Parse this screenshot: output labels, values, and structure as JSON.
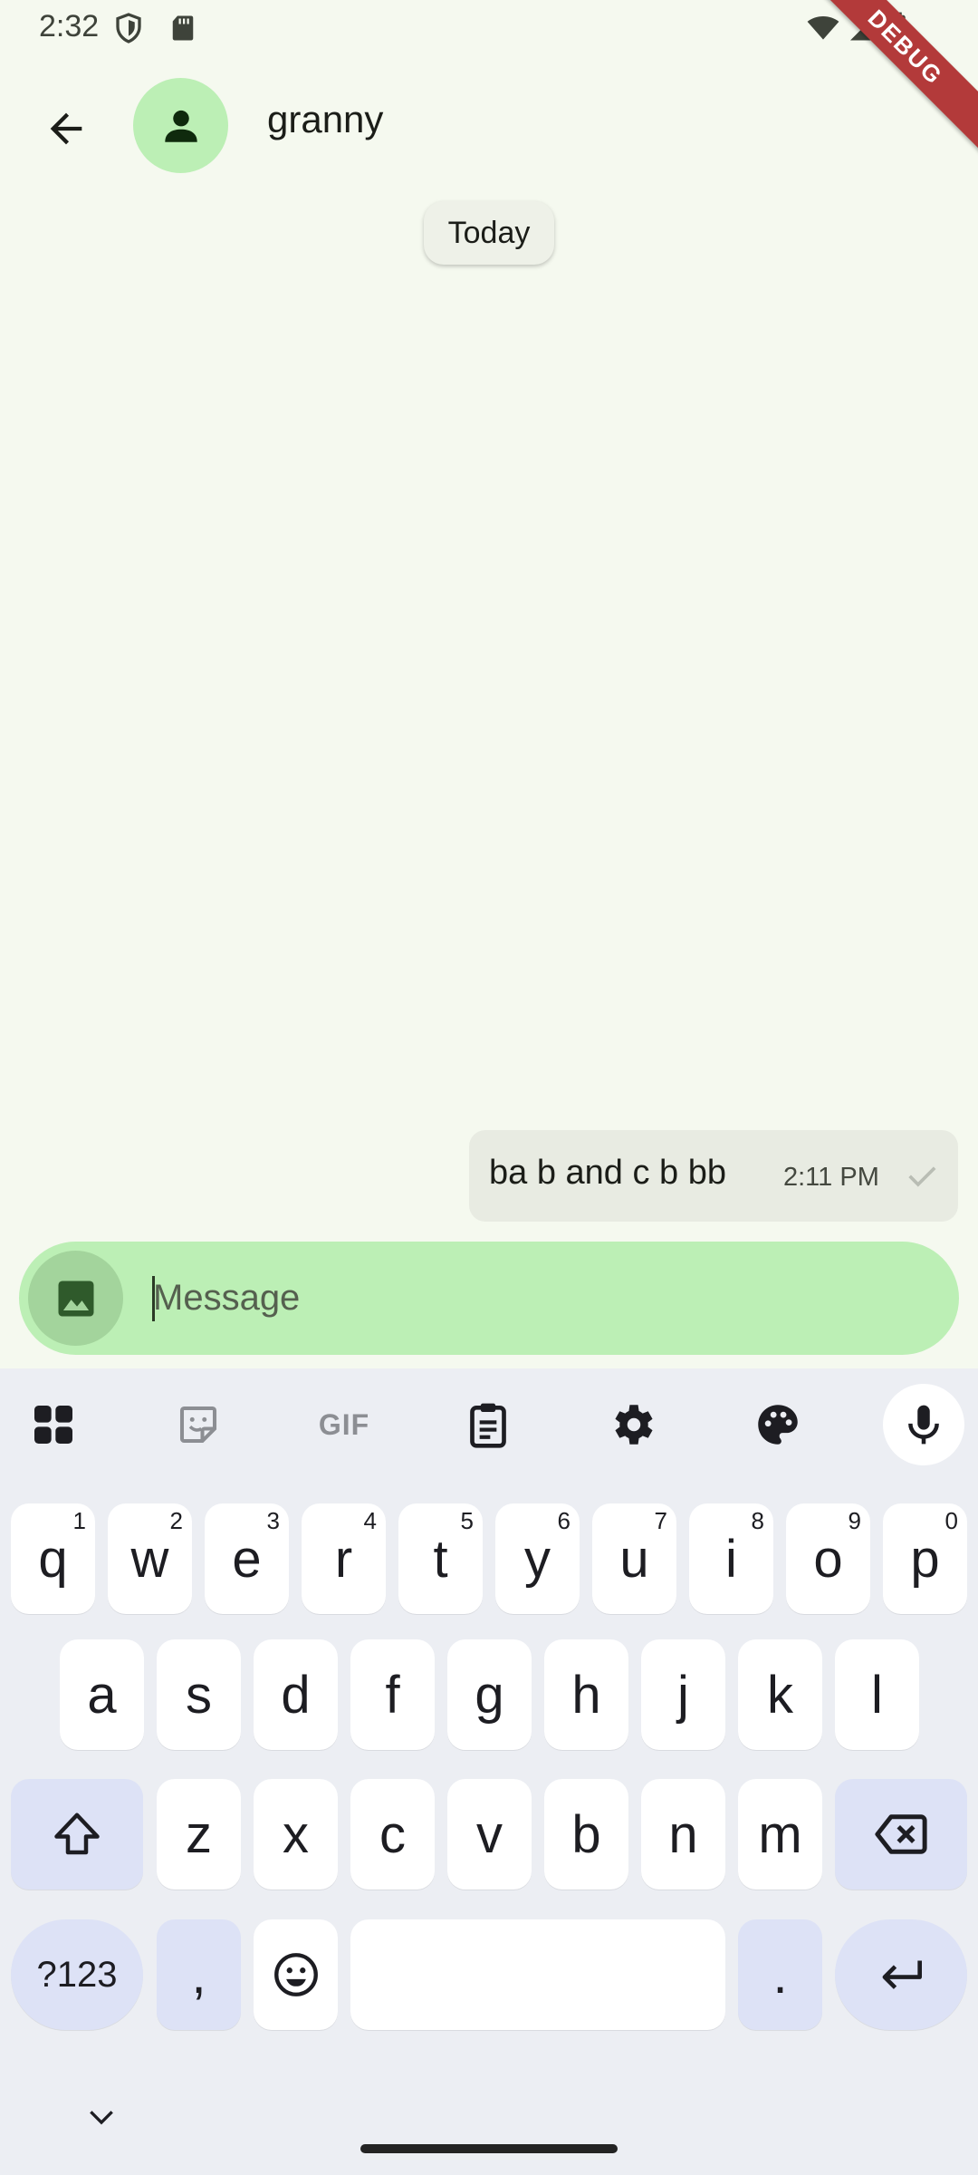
{
  "status": {
    "time": "2:32",
    "icons": [
      "shield-icon",
      "sd-card-icon",
      "wifi-icon",
      "signal-icon",
      "battery-icon"
    ],
    "debug_label": "DEBUG"
  },
  "header": {
    "contact_name": "granny",
    "back_icon": "arrow-left-icon",
    "avatar_icon": "person-icon"
  },
  "conversation": {
    "date_chip": "Today",
    "messages": [
      {
        "text": "ba b and c b bb",
        "time": "2:11 PM",
        "status_icon": "check-icon",
        "outgoing": true
      }
    ]
  },
  "composer": {
    "placeholder": "Message",
    "value": "",
    "attach_icon": "image-icon"
  },
  "keyboard": {
    "toolbar": [
      "apps-grid-icon",
      "sticker-icon",
      "gif-icon",
      "clipboard-icon",
      "settings-icon",
      "palette-icon",
      "mic-icon"
    ],
    "gif_label": "GIF",
    "row1": [
      {
        "k": "q",
        "h": "1"
      },
      {
        "k": "w",
        "h": "2"
      },
      {
        "k": "e",
        "h": "3"
      },
      {
        "k": "r",
        "h": "4"
      },
      {
        "k": "t",
        "h": "5"
      },
      {
        "k": "y",
        "h": "6"
      },
      {
        "k": "u",
        "h": "7"
      },
      {
        "k": "i",
        "h": "8"
      },
      {
        "k": "o",
        "h": "9"
      },
      {
        "k": "p",
        "h": "0"
      }
    ],
    "row2": [
      "a",
      "s",
      "d",
      "f",
      "g",
      "h",
      "j",
      "k",
      "l"
    ],
    "row3": [
      "z",
      "x",
      "c",
      "v",
      "b",
      "n",
      "m"
    ],
    "symbols_label": "?123",
    "comma": ",",
    "period": ".",
    "colors": {
      "key": "#ffffff",
      "special": "#dde2f6",
      "background": "#eceef3"
    }
  },
  "colors": {
    "accent": "#bcefb5",
    "bubble": "#e8ebe2",
    "background": "#f5f9ef"
  }
}
